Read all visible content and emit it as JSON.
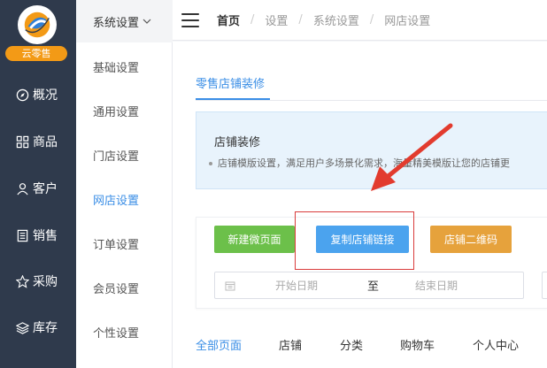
{
  "brand": {
    "badge": "云零售"
  },
  "nav": {
    "items": [
      {
        "label": "概况",
        "icon": "compass-icon"
      },
      {
        "label": "商品",
        "icon": "grid-icon"
      },
      {
        "label": "客户",
        "icon": "user-icon"
      },
      {
        "label": "销售",
        "icon": "document-icon"
      },
      {
        "label": "采购",
        "icon": "shop-icon"
      },
      {
        "label": "库存",
        "icon": "layers-icon"
      }
    ]
  },
  "submenu": {
    "header": "系统设置",
    "items": [
      {
        "label": "基础设置",
        "active": false
      },
      {
        "label": "通用设置",
        "active": false
      },
      {
        "label": "门店设置",
        "active": false
      },
      {
        "label": "网店设置",
        "active": true
      },
      {
        "label": "订单设置",
        "active": false
      },
      {
        "label": "会员设置",
        "active": false
      },
      {
        "label": "个性设置",
        "active": false
      }
    ]
  },
  "breadcrumb": [
    "首页",
    "设置",
    "系统设置",
    "网店设置"
  ],
  "main": {
    "tab": "零售店铺装修",
    "info": {
      "title": "店铺装修",
      "desc": "店铺模版设置，满足用户多场景化需求，海量精美模版让您的店铺更"
    },
    "buttons": {
      "new_page": "新建微页面",
      "copy_link": "复制店铺链接",
      "qrcode": "店铺二维码"
    },
    "date": {
      "start_placeholder": "开始日期",
      "to": "至",
      "end_placeholder": "结束日期"
    },
    "page_tabs": [
      "全部页面",
      "店铺",
      "分类",
      "购物车",
      "个人中心"
    ]
  },
  "colors": {
    "accent": "#3a8ee6",
    "nav_bg": "#2f3a4c",
    "brand_orange": "#f39a16",
    "green": "#6cc04a",
    "blue": "#4ba3ee",
    "orange": "#e6a23c",
    "annotation_red": "#d93c3c"
  }
}
